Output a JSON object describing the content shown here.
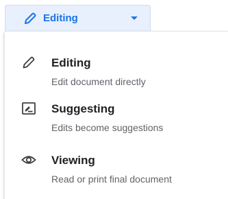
{
  "mode_button": {
    "label": "Editing",
    "icon": "pencil-icon",
    "accent_color": "#1a73e8",
    "background_color": "#e8f0fe"
  },
  "menu": {
    "items": [
      {
        "title": "Editing",
        "description": "Edit document directly",
        "icon": "pencil-icon",
        "selected": true
      },
      {
        "title": "Suggesting",
        "description": "Edits become suggestions",
        "icon": "suggest-edit-icon",
        "selected": false
      },
      {
        "title": "Viewing",
        "description": "Read or print final document",
        "icon": "eye-icon",
        "selected": false
      }
    ]
  }
}
